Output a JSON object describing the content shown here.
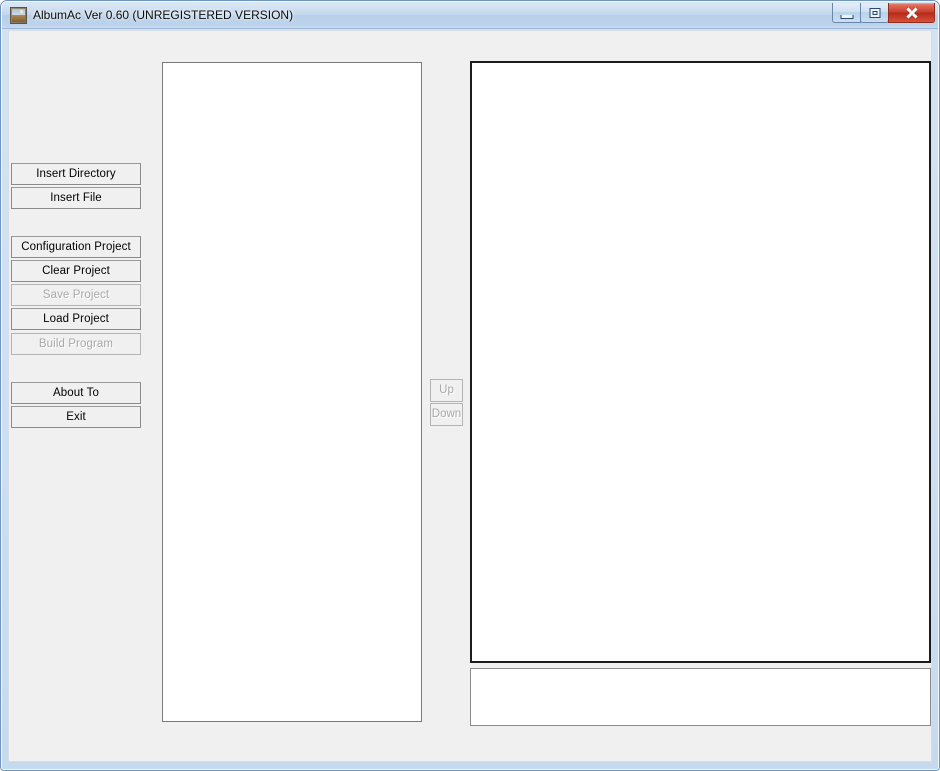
{
  "window": {
    "title": "AlbumAc Ver 0.60 (UNREGISTERED VERSION)",
    "icon": "album-photo-icon",
    "controls": {
      "minimize": "minimize-icon",
      "maximize": "maximize-icon",
      "close": "close-icon"
    },
    "colors": {
      "frame": "#c6daee",
      "titlebar": "#bed4ec",
      "client_background": "#f0f0f0",
      "close_button": "#c93a27",
      "disabled_text": "#a8a8a8",
      "panel_background": "#ffffff"
    }
  },
  "buttons": {
    "group_file": [
      {
        "label": "Insert Directory",
        "name": "insert-directory-button",
        "enabled": true
      },
      {
        "label": "Insert File",
        "name": "insert-file-button",
        "enabled": true
      }
    ],
    "group_project": [
      {
        "label": "Configuration Project",
        "name": "configuration-project-button",
        "enabled": true
      },
      {
        "label": "Clear Project",
        "name": "clear-project-button",
        "enabled": true
      },
      {
        "label": "Save Project",
        "name": "save-project-button",
        "enabled": false
      },
      {
        "label": "Load Project",
        "name": "load-project-button",
        "enabled": true
      },
      {
        "label": "Build Program",
        "name": "build-program-button",
        "enabled": false
      }
    ],
    "group_app": [
      {
        "label": "About To",
        "name": "about-to-button",
        "enabled": true
      },
      {
        "label": "Exit",
        "name": "exit-button",
        "enabled": true
      }
    ]
  },
  "reorder": {
    "up_label": "Up",
    "down_label": "Down",
    "enabled": false
  },
  "panels": {
    "source_list": {
      "items": [],
      "empty": true
    },
    "album_list": {
      "items": [],
      "empty": true
    },
    "status_box": {
      "text": "",
      "empty": true
    }
  }
}
